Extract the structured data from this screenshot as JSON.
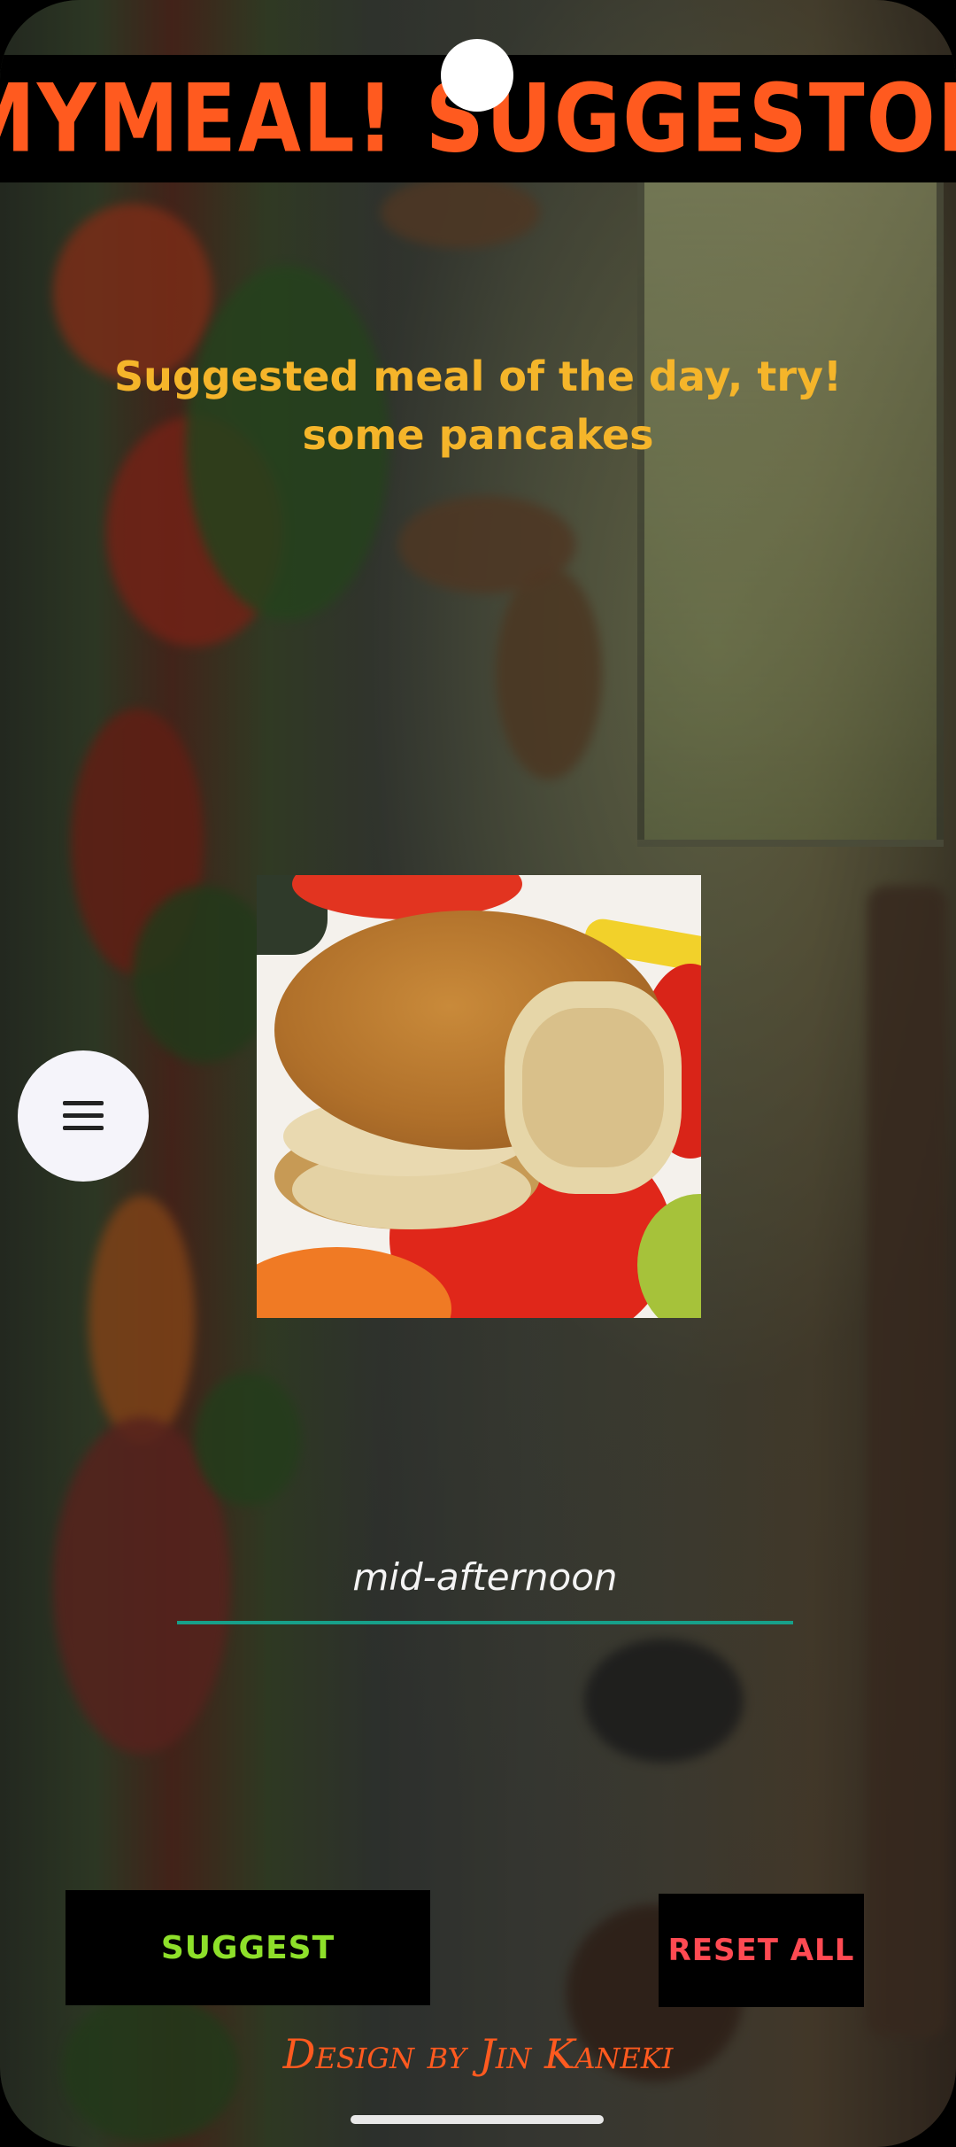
{
  "header": {
    "title": "MYMEAL! SUGGESTOR"
  },
  "suggestion": {
    "line1": "Suggested meal of the day, try!",
    "line2": "some pancakes"
  },
  "meal_image": {
    "alt": "pancakes"
  },
  "time_field": {
    "value": "mid-afternoon"
  },
  "actions": {
    "suggest_label": "SUGGEST",
    "reset_label": "RESET ALL"
  },
  "footer": {
    "credit": "Design by Jin Kaneki"
  },
  "icons": {
    "menu": "hamburger-menu-icon"
  },
  "colors": {
    "title": "#ff5a1f",
    "suggestion_text": "#f5b52a",
    "suggest_button_text": "#8ee02a",
    "reset_button_text": "#ff4a52",
    "input_underline": "#17a08a"
  }
}
